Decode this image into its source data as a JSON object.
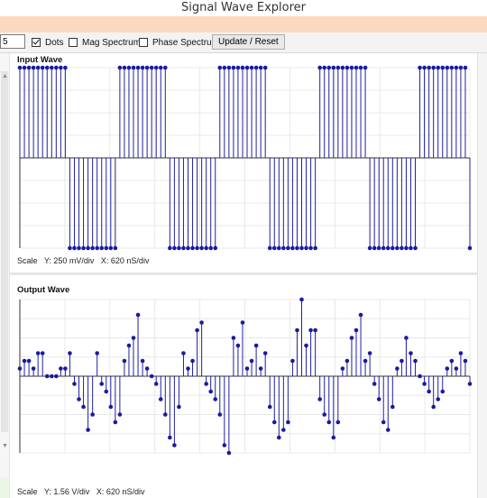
{
  "window": {
    "title": "Signal Wave Explorer"
  },
  "toolbar": {
    "number_value": "5",
    "dots_label": "Dots",
    "dots_checked": true,
    "mag_label": "Mag Spectrum",
    "mag_checked": false,
    "phase_label": "Phase Spectrum",
    "phase_checked": false,
    "update_label": "Update / Reset"
  },
  "colors": {
    "stem": "#2020a0",
    "dot": "#1a1aa0",
    "grid": "#e8e8e8",
    "axis": "#333333"
  },
  "chart_data": [
    {
      "type": "stem",
      "title": "Input Wave",
      "scale_label": "Scale",
      "y_scale": "Y: 250 mV/div",
      "x_scale": "X: 620 nS/div",
      "ylim": [
        -1,
        1
      ],
      "values": [
        1,
        1,
        1,
        1,
        1,
        1,
        1,
        1,
        1,
        1,
        1,
        -1,
        -1,
        -1,
        -1,
        -1,
        -1,
        -1,
        -1,
        -1,
        -1,
        -1,
        1,
        1,
        1,
        1,
        1,
        1,
        1,
        1,
        1,
        1,
        1,
        -1,
        -1,
        -1,
        -1,
        -1,
        -1,
        -1,
        -1,
        -1,
        -1,
        -1,
        1,
        1,
        1,
        1,
        1,
        1,
        1,
        1,
        1,
        1,
        1,
        -1,
        -1,
        -1,
        -1,
        -1,
        -1,
        -1,
        -1,
        -1,
        -1,
        -1,
        1,
        1,
        1,
        1,
        1,
        1,
        1,
        1,
        1,
        1,
        1,
        -1,
        -1,
        -1,
        -1,
        -1,
        -1,
        -1,
        -1,
        -1,
        -1,
        -1,
        1,
        1,
        1,
        1,
        1,
        1,
        1,
        1,
        1,
        1,
        1,
        -1
      ]
    },
    {
      "type": "stem",
      "title": "Output Wave",
      "scale_label": "Scale",
      "y_scale": "Y: 1.56 V/div",
      "x_scale": "X: 620 nS/div",
      "ylim": [
        -1,
        1
      ],
      "values": [
        0.1,
        0.2,
        0.2,
        0.1,
        0.3,
        0.3,
        0.0,
        0.0,
        0.0,
        0.1,
        0.1,
        0.3,
        -0.1,
        -0.3,
        -0.4,
        -0.7,
        -0.5,
        0.3,
        -0.1,
        -0.2,
        -0.4,
        -0.6,
        -0.5,
        0.2,
        0.4,
        0.5,
        0.8,
        0.2,
        0.1,
        0.0,
        -0.1,
        -0.3,
        -0.5,
        -0.8,
        -0.9,
        -0.4,
        0.3,
        0.1,
        0.2,
        0.6,
        0.7,
        -0.1,
        -0.2,
        -0.3,
        -0.5,
        -0.9,
        -1.0,
        0.5,
        0.4,
        0.7,
        0.1,
        0.2,
        0.4,
        0.1,
        0.3,
        -0.4,
        -0.6,
        -0.8,
        -0.7,
        -0.6,
        0.2,
        0.6,
        1.0,
        0.4,
        0.6,
        0.6,
        -0.3,
        -0.5,
        -0.6,
        -0.8,
        -0.6,
        0.1,
        0.2,
        0.5,
        0.6,
        0.8,
        0.2,
        0.3,
        -0.1,
        -0.3,
        -0.6,
        -0.7,
        -0.4,
        0.1,
        0.2,
        0.5,
        0.3,
        0.2,
        0.0,
        -0.1,
        -0.2,
        -0.4,
        -0.3,
        -0.2,
        0.1,
        0.2,
        0.1,
        0.3,
        0.2,
        -0.1
      ]
    }
  ]
}
